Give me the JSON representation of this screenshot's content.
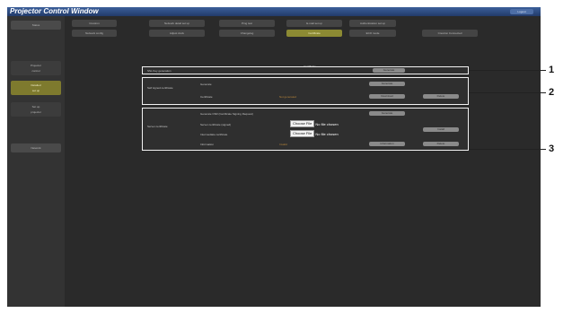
{
  "window": {
    "title": "Projector Control Window",
    "logout_label": "Logout"
  },
  "sidebar": {
    "items": [
      {
        "line1": "Status",
        "line2": ""
      },
      {
        "line1": "Projector",
        "line2": "control"
      },
      {
        "line1": "Detailed",
        "line2": "set up"
      },
      {
        "line1": "Set up",
        "line2": "projector"
      },
      {
        "line1": "Network",
        "line2": ""
      }
    ]
  },
  "tabs": {
    "row1": [
      "Crestron",
      "Network detail set up",
      "Ping test",
      "E-mail set up",
      "Authentication set up"
    ],
    "row2": [
      "Network config",
      "Adjust clock",
      "Changelog",
      "Certificate",
      "ECO mode",
      "Crestron Connected"
    ]
  },
  "content_title": "Certificate",
  "panel1": {
    "label": "SSL Key generation",
    "button_label": "Generate"
  },
  "panel2": {
    "section_label": "Self signed certificate",
    "row1_label": "Generate",
    "row2_label": "Certificate",
    "status": "Not generated",
    "row1_button": "Generate",
    "row2_button_a": "Download",
    "row2_button_b": "Delete"
  },
  "panel3": {
    "section_label": "Server certificate",
    "row1_label": "Generate CSR (Certificate Signing Request)",
    "row2_label": "Server certificate (signed)",
    "row3_label": "Intermediate certificate",
    "row4_label": "Information",
    "status": "Invalid",
    "row1_button": "Generate",
    "install_button": "Install",
    "info_button": "Information",
    "delete_button": "Delete",
    "choose_file_label": "Choose File",
    "no_file_label": "No file chosen"
  },
  "callouts": [
    "1",
    "2",
    "3"
  ]
}
